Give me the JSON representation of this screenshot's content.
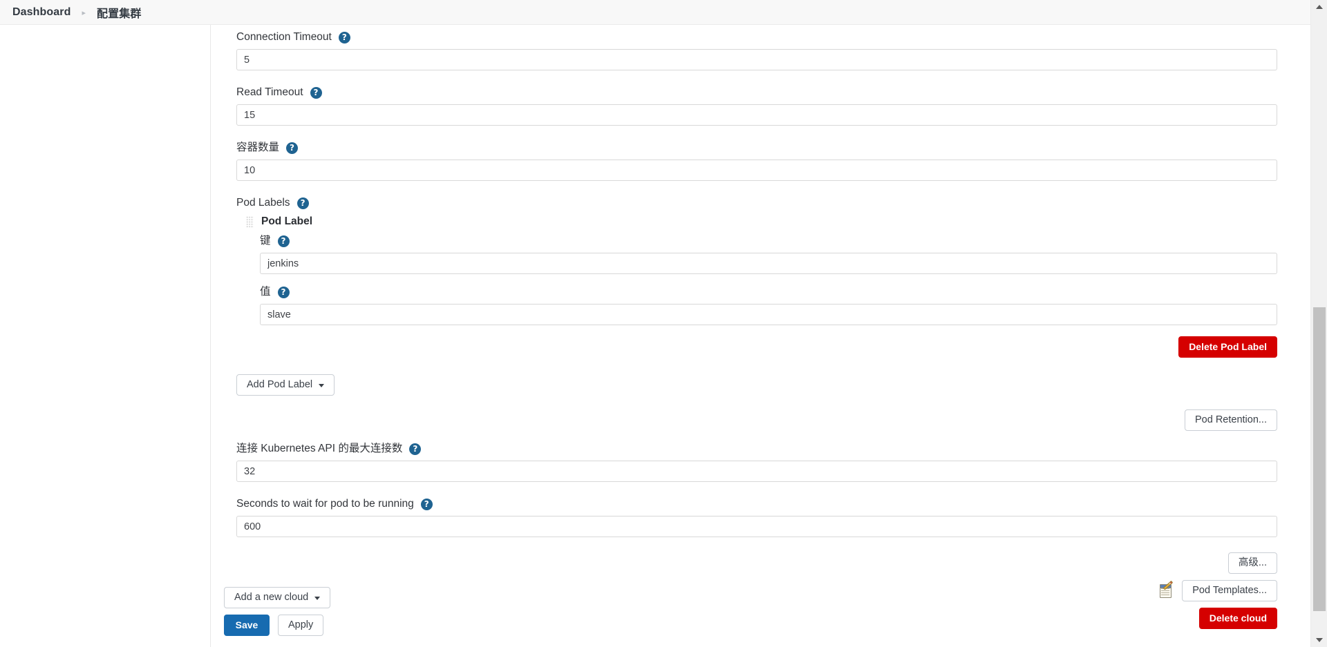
{
  "breadcrumb": {
    "items": [
      {
        "label": "Dashboard",
        "sep": "▸"
      },
      {
        "label": "配置集群"
      }
    ],
    "separator": "▸"
  },
  "help_glyph": "?",
  "form": {
    "connection_timeout": {
      "label": "Connection Timeout",
      "value": "5",
      "placeholder": ""
    },
    "read_timeout": {
      "label": "Read Timeout",
      "value": "15",
      "placeholder": ""
    },
    "container_cap": {
      "label": "容器数量",
      "value": "10",
      "placeholder": ""
    },
    "pod_labels": {
      "label": "Pod Labels",
      "entries": [
        {
          "title": "Pod Label",
          "key_label": "键",
          "key_value": "jenkins",
          "value_label": "值",
          "value_value": "slave",
          "delete_label": "Delete Pod Label"
        }
      ],
      "add_label": "Add Pod Label"
    },
    "pod_retention_label": "Pod Retention...",
    "max_connections": {
      "label": "连接 Kubernetes API 的最大连接数",
      "value": "32",
      "placeholder": ""
    },
    "wait_seconds": {
      "label": "Seconds to wait for pod to be running",
      "value": "600",
      "placeholder": ""
    },
    "advanced_label": "高级...",
    "pod_templates_label": "Pod Templates...",
    "delete_cloud_label": "Delete cloud",
    "add_cloud_label": "Add a new cloud",
    "save_label": "Save",
    "apply_label": "Apply"
  },
  "colors": {
    "primary": "#176bb0",
    "danger": "#d50000",
    "help_badge": "#1f6391",
    "header_bg": "#f8f8f8",
    "input_border": "#d8d8d8",
    "scrollbar_thumb": "#c1c1c1"
  }
}
